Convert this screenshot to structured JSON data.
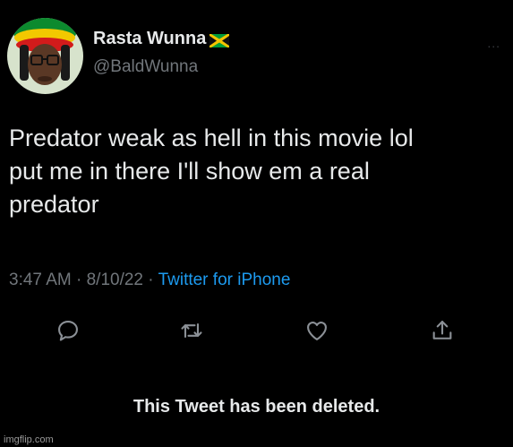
{
  "tweet": {
    "display_name": "Rasta Wunna",
    "flag_icon": "jamaica-flag-icon",
    "handle": "@BaldWunna",
    "more_icon": "more-options-icon",
    "more_label": "...",
    "text_lines": [
      "Predator weak as hell in this movie lol",
      "put me in there I'll show em a real",
      "predator"
    ],
    "time": "3:47 AM",
    "separator": "·",
    "date": "8/10/22",
    "source": "Twitter for iPhone",
    "actions": [
      "reply-icon",
      "retweet-icon",
      "like-icon",
      "share-icon"
    ],
    "deleted_notice": "This Tweet has been deleted."
  },
  "watermark": "imgflip.com",
  "colors": {
    "background": "#000000",
    "text": "#e7e9ea",
    "muted": "#71767b",
    "link": "#1d9bf0"
  }
}
